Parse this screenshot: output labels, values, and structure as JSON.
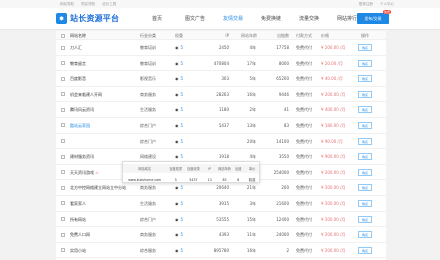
{
  "topbar": {
    "left": [
      "网站导航",
      "购买须知",
      "站长工具"
    ],
    "right": [
      "登录注册",
      "个人中心"
    ]
  },
  "header": {
    "logo_text": "站长资源平台",
    "nav": [
      "首页",
      "图文广告",
      "友情交易",
      "免费换链",
      "流量交换",
      "网站排行"
    ],
    "active_index": 2,
    "publish_label": "发布/交易",
    "publish_badge": "免费"
  },
  "table": {
    "headers": [
      "网站名称",
      "行业分类",
      "权重",
      "IP",
      "网站年龄",
      "出链数",
      "付款方式",
      "价格",
      "操作"
    ],
    "rows": [
      {
        "name": "刀人汇",
        "cat": "教育培训",
        "w": "5",
        "ip": "2450",
        "age": "4年",
        "bl": "17758",
        "pay": "免费代付",
        "price": "¥ 200.00 /月",
        "op": "购买"
      },
      {
        "name": "教育留言",
        "cat": "教育培训",
        "w": "5",
        "ip": "470804",
        "age": "17年",
        "bl": "8000",
        "pay": "免费代付",
        "price": "¥ 20.00 /月",
        "op": "购买"
      },
      {
        "name": "百度影音",
        "cat": "影视音乐",
        "w": "5",
        "ip": "303",
        "age": "5年",
        "bl": "65200",
        "pay": "免费代付",
        "price": "¥ 40.00 /月",
        "op": "购买"
      },
      {
        "name": "机会来临建人开网",
        "cat": "商务服务",
        "w": "5",
        "ip": "28263",
        "age": "16年",
        "bl": "9446",
        "pay": "免费代付",
        "price": "¥ 200.00 /月",
        "op": "购买"
      },
      {
        "name": "腾讯风云资讯",
        "cat": "生活服务",
        "w": "5",
        "ip": "1180",
        "age": "2年",
        "bl": "41",
        "pay": "免费代付",
        "price": "¥ 400.00 /月",
        "op": "购买"
      },
      {
        "name": "酷站云家园",
        "cat": "综合门户",
        "w": "5",
        "ip": "5437",
        "age": "13年",
        "bl": "83",
        "pay": "免费代付",
        "price": "¥ 180.00 /月",
        "op": "购买",
        "highlight": true
      },
      {
        "name": "",
        "cat": "综合门户",
        "w": "5",
        "ip": "",
        "age": "20年",
        "bl": "14100",
        "pay": "免费代付",
        "price": "¥ 90.00 /月",
        "op": "购买"
      },
      {
        "name": "建材服务资讯",
        "cat": "网络建设",
        "w": "5",
        "ip": "1918",
        "age": "4年",
        "bl": "3550",
        "pay": "免费代付",
        "price": "¥ 900.00 /月",
        "op": "购买"
      },
      {
        "name": "天天资讯游戏",
        "cat": "娱乐休闲",
        "w": "5",
        "ip": "50955",
        "age": "14年",
        "bl": "254000",
        "pay": "免费代付",
        "price": "¥ 200.00 /月",
        "op": "购买",
        "fire": true
      },
      {
        "name": "北方中控网络建立网站立中分站",
        "cat": "商务服务",
        "w": "5",
        "ip": "20640",
        "age": "21年",
        "bl": "200",
        "pay": "免费代付",
        "price": "¥ 200.00 /月",
        "op": "购买"
      },
      {
        "name": "看家家人",
        "cat": "生活服务",
        "w": "5",
        "ip": "3915",
        "age": "3年",
        "bl": "21600",
        "pay": "免费代付",
        "price": "¥ 200.00 /月",
        "op": "购买"
      },
      {
        "name": "所有网站",
        "cat": "综合门户",
        "w": "5",
        "ip": "53555",
        "age": "15年",
        "bl": "12400",
        "pay": "免费代付",
        "price": "¥ 200.00 /月",
        "op": "购买"
      },
      {
        "name": "免费人口网",
        "cat": "商务服务",
        "w": "5",
        "ip": "4393",
        "age": "11年",
        "bl": "24000",
        "pay": "免费代付",
        "price": "¥ 200.00 /月",
        "op": "购买"
      },
      {
        "name": "实用小站",
        "cat": "综合服务",
        "w": "5",
        "ip": "895780",
        "age": "16年",
        "bl": "2",
        "pay": "免费代付",
        "price": "¥ 200.00 /月",
        "op": "购买"
      }
    ]
  },
  "popup": {
    "headers": [
      "网站域名",
      "百度权重",
      "百度收录",
      "IP",
      "网站年龄",
      "出链",
      "单价"
    ],
    "values": [
      "www.kukuhome.com",
      "5",
      "5437",
      "13",
      "83",
      "8",
      "精选"
    ]
  },
  "colors": {
    "accent": "#1e88e5",
    "price": "#e57373",
    "badge": "#f44336"
  }
}
